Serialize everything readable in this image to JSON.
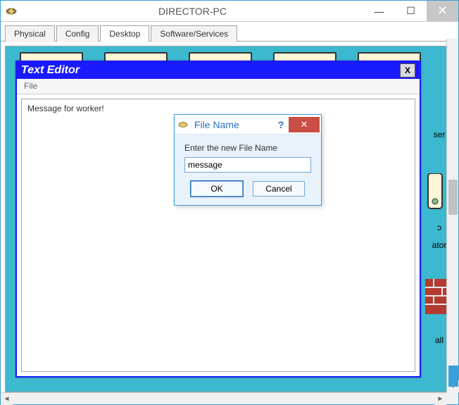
{
  "app": {
    "title": "DIRECTOR-PC"
  },
  "tabs": [
    {
      "label": "Physical",
      "active": false
    },
    {
      "label": "Config",
      "active": false
    },
    {
      "label": "Desktop",
      "active": true
    },
    {
      "label": "Software/Services",
      "active": false
    }
  ],
  "sideLabels": {
    "l1": "ser",
    "l2": "ɔ",
    "l3": "ator",
    "l4": "all"
  },
  "textEditor": {
    "title": "Text Editor",
    "closeLabel": "X",
    "menu": {
      "file": "File"
    },
    "content": "Message for worker!"
  },
  "fileNameDialog": {
    "title": "File Name",
    "help": "?",
    "close": "✕",
    "prompt": "Enter the new File Name",
    "value": "message",
    "ok": "OK",
    "cancel": "Cancel"
  },
  "winControls": {
    "min": "—",
    "max": "☐",
    "close": "✕"
  },
  "scroll": {
    "left": "◄",
    "right": "►",
    "down": "▼"
  }
}
